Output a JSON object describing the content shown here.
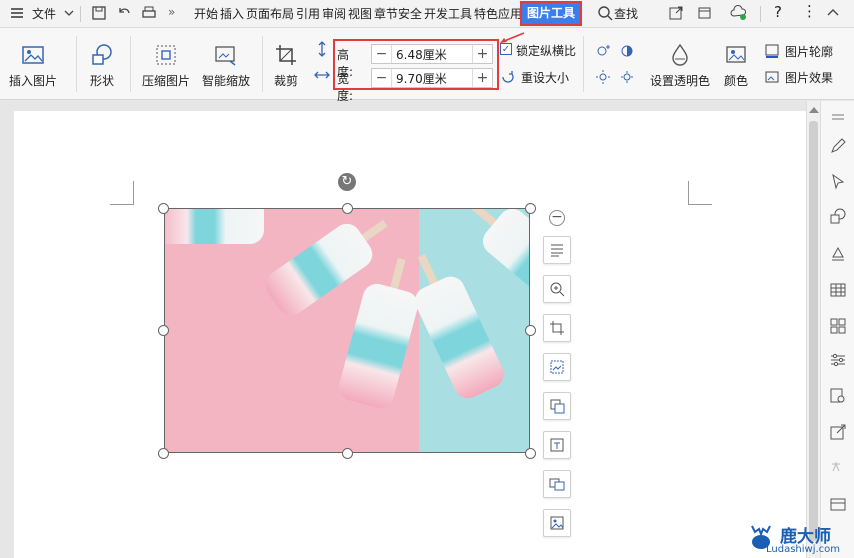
{
  "menubar": {
    "menu_label": "文件",
    "tabs": [
      "开始",
      "插入",
      "页面布局",
      "引用",
      "审阅",
      "视图",
      "章节",
      "安全",
      "开发工具",
      "特色应用"
    ],
    "active_tab": "图片工具",
    "search_label": "查找"
  },
  "ribbon": {
    "insert_picture": "插入图片",
    "shape": "形状",
    "compress_picture": "压缩图片",
    "smart_scale": "智能缩放",
    "crop": "裁剪",
    "height_label": "高度:",
    "height_value": "6.48厘米",
    "width_label": "宽度:",
    "width_value": "9.70厘米",
    "lock_ratio": "锁定纵横比",
    "lock_ratio_checked": true,
    "reset_size": "重设大小",
    "set_transparent": "设置透明色",
    "color": "颜色",
    "picture_outline": "图片轮廓",
    "picture_effect": "图片效果"
  },
  "colors": {
    "accent": "#3b7de9",
    "highlight": "#e03c3c",
    "pink": "#f3b5c1",
    "teal": "#a9dfe3"
  },
  "watermark": {
    "title": "鹿大师",
    "url": "Ludashiwj.com"
  }
}
